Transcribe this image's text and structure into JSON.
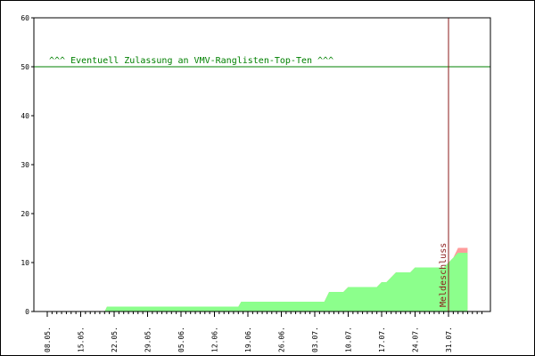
{
  "chart_data": {
    "type": "area",
    "x_tick_labels": [
      "08.05.",
      "15.05.",
      "22.05.",
      "29.05.",
      "05.06.",
      "12.06.",
      "19.06.",
      "26.06.",
      "03.07.",
      "10.07.",
      "17.07.",
      "24.07.",
      "31.07."
    ],
    "y_ticks": [
      0,
      10,
      20,
      30,
      40,
      50,
      60
    ],
    "ylim": [
      0,
      60
    ],
    "x_domain_days": [
      0,
      91
    ],
    "grid": false,
    "series": [
      {
        "role": "lower-area",
        "color": "#8cff8c",
        "points": [
          [
            0,
            0
          ],
          [
            12,
            0
          ],
          [
            12.5,
            1
          ],
          [
            40,
            1
          ],
          [
            40.6,
            2
          ],
          [
            58,
            2
          ],
          [
            59,
            4
          ],
          [
            62,
            4
          ],
          [
            63,
            5
          ],
          [
            69,
            5
          ],
          [
            70,
            6
          ],
          [
            71,
            6
          ],
          [
            73,
            8
          ],
          [
            76,
            8
          ],
          [
            77,
            9
          ],
          [
            83,
            9
          ],
          [
            84,
            10
          ],
          [
            85,
            11
          ],
          [
            86,
            12
          ],
          [
            88,
            12
          ]
        ]
      },
      {
        "role": "upper-area",
        "color": "#ff9c9c",
        "points": [
          [
            0,
            0
          ],
          [
            12,
            0
          ],
          [
            12.5,
            1
          ],
          [
            40,
            1
          ],
          [
            40.6,
            2
          ],
          [
            58,
            2
          ],
          [
            59,
            4
          ],
          [
            62,
            4
          ],
          [
            63,
            5
          ],
          [
            69,
            5
          ],
          [
            70,
            6
          ],
          [
            71,
            6
          ],
          [
            73,
            8
          ],
          [
            76,
            8
          ],
          [
            77,
            9
          ],
          [
            83,
            9
          ],
          [
            84,
            10
          ],
          [
            85,
            11
          ],
          [
            86,
            13
          ],
          [
            88,
            13
          ]
        ]
      }
    ],
    "threshold": {
      "value": 50,
      "label": "^^^ Eventuell Zulassung an VMV-Ranglisten-Top-Ten ^^^",
      "color": "#008000"
    },
    "deadline": {
      "x_day": 84,
      "label": "Meldeschluss",
      "color": "#8b1a1a"
    }
  }
}
